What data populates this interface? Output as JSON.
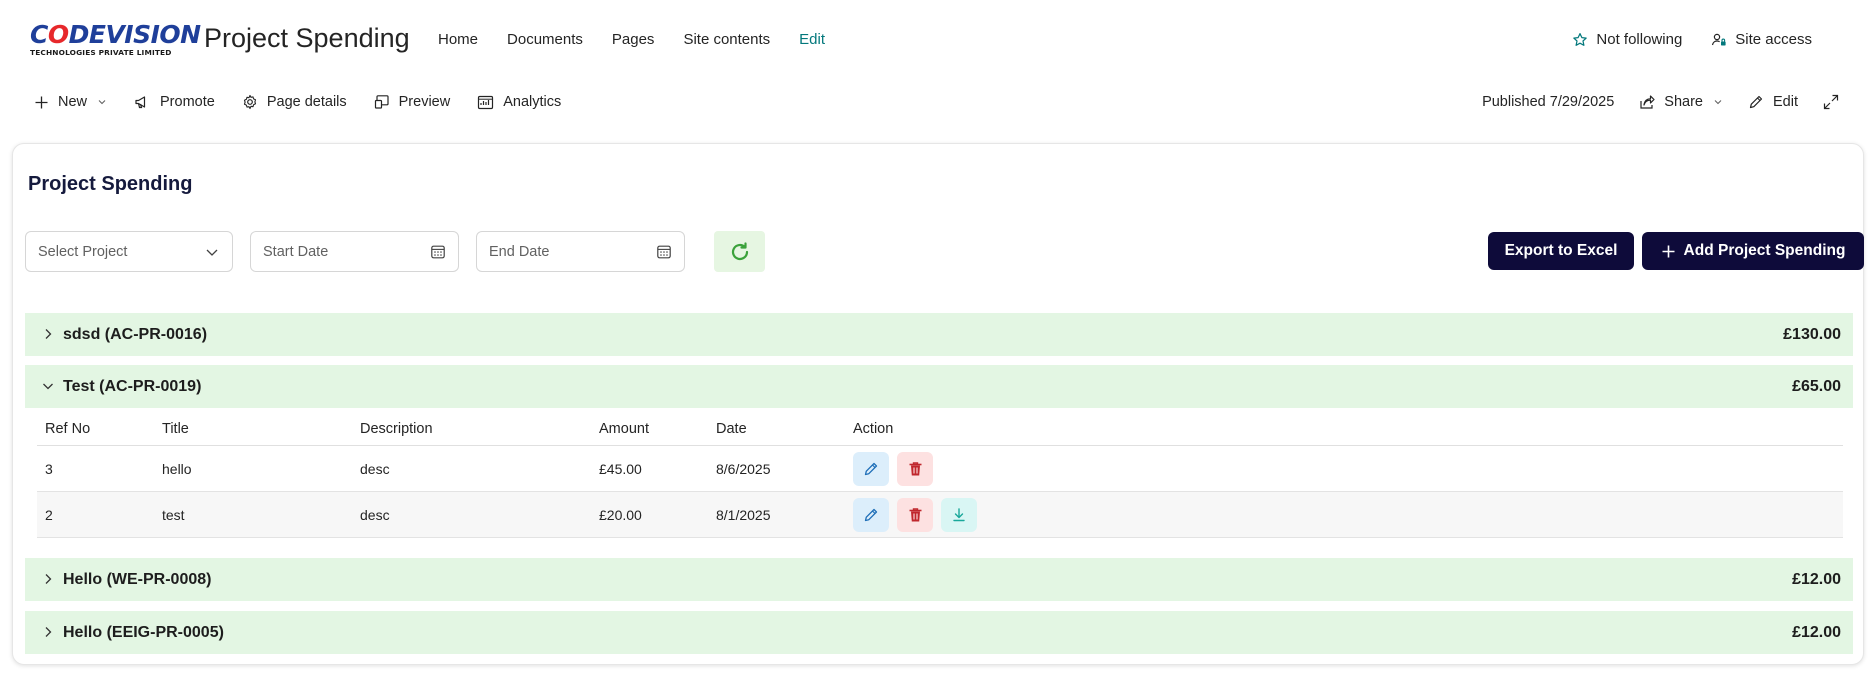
{
  "logo": {
    "main_prefix": "C",
    "main_o": "O",
    "main_suffix": "DEVISION",
    "sub": "TECHNOLOGIES PRIVATE LIMITED"
  },
  "site": {
    "title": "Project Spending"
  },
  "nav": {
    "items": [
      {
        "label": "Home"
      },
      {
        "label": "Documents"
      },
      {
        "label": "Pages"
      },
      {
        "label": "Site contents"
      },
      {
        "label": "Edit"
      }
    ],
    "not_following": "Not following",
    "site_access": "Site access"
  },
  "commands": {
    "new": "New",
    "promote": "Promote",
    "page_details": "Page details",
    "preview": "Preview",
    "analytics": "Analytics",
    "published": "Published 7/29/2025",
    "share": "Share",
    "edit": "Edit"
  },
  "card": {
    "title": "Project Spending"
  },
  "filters": {
    "project_placeholder": "Select Project",
    "start_placeholder": "Start Date",
    "end_placeholder": "End Date"
  },
  "buttons": {
    "export": "Export to Excel",
    "add": "Add Project Spending"
  },
  "groups": [
    {
      "name": "sdsd (AC-PR-0016)",
      "amount": "£130.00",
      "expanded": false
    },
    {
      "name": "Test (AC-PR-0019)",
      "amount": "£65.00",
      "expanded": true
    },
    {
      "name": "Hello (WE-PR-0008)",
      "amount": "£12.00",
      "expanded": false
    },
    {
      "name": "Hello (EEIG-PR-0005)",
      "amount": "£12.00",
      "expanded": false
    }
  ],
  "table": {
    "headers": [
      "Ref No",
      "Title",
      "Description",
      "Amount",
      "Date",
      "Action"
    ],
    "rows": [
      {
        "ref": "3",
        "title": "hello",
        "description": "desc",
        "amount": "£45.00",
        "date": "8/6/2025"
      },
      {
        "ref": "2",
        "title": "test",
        "description": "desc",
        "amount": "£20.00",
        "date": "8/1/2025"
      }
    ]
  },
  "colors": {
    "dark_button": "#0e0b3a",
    "group_bg": "#e3f6e3",
    "accent": "#03787c"
  }
}
